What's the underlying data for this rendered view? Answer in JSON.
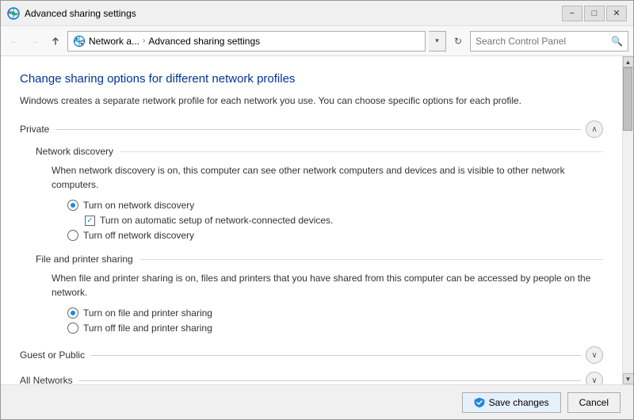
{
  "window": {
    "title": "Advanced sharing settings",
    "minimize_label": "−",
    "maximize_label": "□",
    "close_label": "✕"
  },
  "addressbar": {
    "back_label": "←",
    "forward_label": "→",
    "up_label": "↑",
    "breadcrumb_1": "Network a...",
    "breadcrumb_2": "Advanced sharing settings",
    "refresh_label": "↻",
    "search_placeholder": "Search Control Panel",
    "dropdown_label": "▾"
  },
  "page": {
    "title": "Change sharing options for different network profiles",
    "description": "Windows creates a separate network profile for each network you use. You can choose specific options for each profile."
  },
  "sections": {
    "private": {
      "label": "Private",
      "toggle_label": "∧",
      "network_discovery": {
        "label": "Network discovery",
        "description": "When network discovery is on, this computer can see other network computers and devices and is visible to other network computers.",
        "option1_label": "Turn on network discovery",
        "option1_checked": true,
        "option1_sub_label": "Turn on automatic setup of network-connected devices.",
        "option1_sub_checked": true,
        "option2_label": "Turn off network discovery",
        "option2_checked": false
      },
      "file_sharing": {
        "label": "File and printer sharing",
        "description": "When file and printer sharing is on, files and printers that you have shared from this computer can be accessed by people on the network.",
        "option1_label": "Turn on file and printer sharing",
        "option1_checked": true,
        "option2_label": "Turn off file and printer sharing",
        "option2_checked": false
      }
    },
    "guest_or_public": {
      "label": "Guest or Public",
      "toggle_label": "∨"
    },
    "all_networks": {
      "label": "All Networks",
      "toggle_label": "∨"
    }
  },
  "footer": {
    "save_label": "Save changes",
    "cancel_label": "Cancel"
  }
}
